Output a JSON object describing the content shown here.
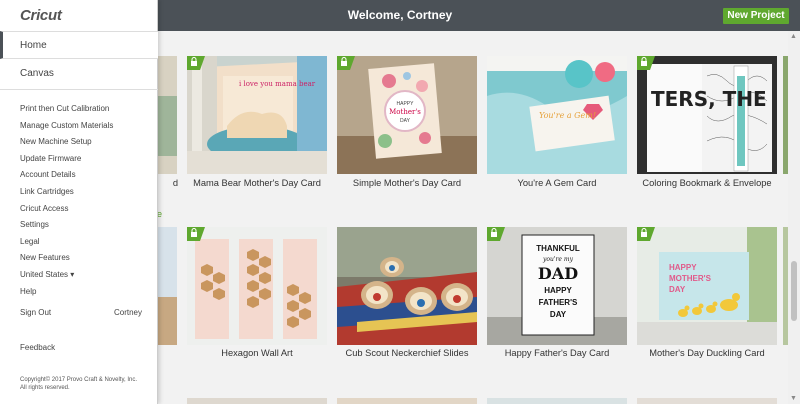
{
  "topbar": {
    "title": "Welcome, Cortney",
    "new_project": "New Project"
  },
  "logo": "Cricut",
  "nav": {
    "home": "Home",
    "canvas": "Canvas"
  },
  "menu": [
    "Print then Cut Calibration",
    "Manage Custom Materials",
    "New Machine Setup",
    "Update Firmware",
    "Account Details",
    "Link Cartridges",
    "Cricut Access",
    "Settings",
    "Legal",
    "New Features",
    "United States ▾",
    "Help"
  ],
  "signout": {
    "label": "Sign Out",
    "user": "Cortney"
  },
  "feedback": "Feedback",
  "copyright": {
    "line1": "Copyright© 2017 Provo Craft & Novelty, Inc.",
    "line2": "All rights reserved."
  },
  "cards": [
    {
      "title": "Mama Bear Mother's Day Card"
    },
    {
      "title": "Simple Mother's Day Card"
    },
    {
      "title": "You're A Gem Card"
    },
    {
      "title": "Coloring Bookmark & Envelope"
    },
    {
      "title": "Hexagon Wall Art"
    },
    {
      "title": "Cub Scout Neckerchief Slides"
    },
    {
      "title": "Happy Father's Day Card"
    },
    {
      "title": "Mother's Day Duckling Card"
    }
  ],
  "card_art": {
    "simple_mday": {
      "line1": "HAPPY",
      "line2": "Mother's",
      "line3": "DAY"
    },
    "gem": "You're a Gem!",
    "bookmark": "TERS, THE",
    "fathers": {
      "l1": "THANKFUL",
      "l2": "you're my",
      "l3": "DAD",
      "l4": "HAPPY",
      "l5": "FATHER'S",
      "l6": "DAY"
    },
    "duckling": {
      "l1": "HAPPY",
      "l2": "MOTHER'S",
      "l3": "DAY"
    },
    "bear": "i love you mama bear"
  },
  "partials": {
    "left_caption_fragment": "d",
    "left_link_fragment": "e"
  },
  "colors": {
    "topbar": "#4b5157",
    "accent": "#5fa82f",
    "badge": "#5fa82f"
  }
}
